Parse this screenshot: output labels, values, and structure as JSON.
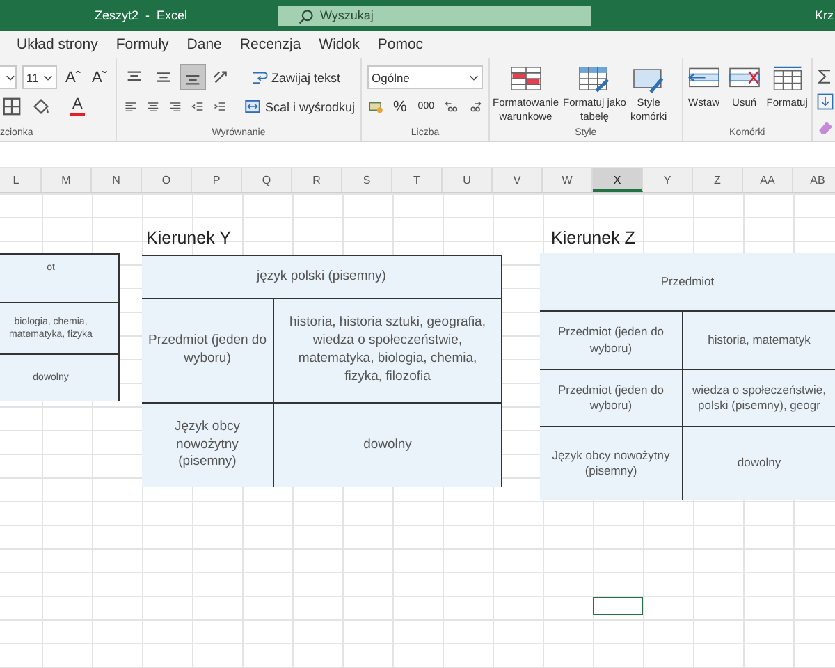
{
  "title_bar": {
    "title": "Zeszyt2  -  Excel",
    "search": {
      "placeholder": "Wyszukaj"
    },
    "user": "Krz"
  },
  "menu": [
    "Układ strony",
    "Formuły",
    "Dane",
    "Recenzja",
    "Widok",
    "Pomoc"
  ],
  "ribbon": [
    {
      "label": "zcionka",
      "rows": [
        [
          {
            "kind": "font-box"
          },
          {
            "kind": "dropdown",
            "value": "11"
          },
          {
            "kind": "glyph",
            "label": "Aˆ"
          },
          {
            "kind": "glyph",
            "label": "Aˇ"
          }
        ],
        [
          {
            "kind": "borders"
          },
          {
            "kind": "fill"
          },
          {
            "kind": "font-color",
            "label": "A"
          }
        ]
      ]
    },
    {
      "label": "Wyrównanie",
      "rows": [
        [
          {
            "kind": "align-top",
            "on": false
          },
          {
            "kind": "align-middle",
            "on": false
          },
          {
            "kind": "align-bottom",
            "on": true
          },
          {
            "kind": "orientation"
          },
          {
            "kind": "wrap",
            "label": "Zawijaj tekst"
          }
        ],
        [
          {
            "kind": "align-left",
            "on": false
          },
          {
            "kind": "align-center",
            "on": false
          },
          {
            "kind": "align-right",
            "on": false
          },
          {
            "kind": "indent-less"
          },
          {
            "kind": "indent-more"
          },
          {
            "kind": "merge",
            "label": "Scal i wyśrodkuj"
          }
        ]
      ]
    },
    {
      "label": "Liczba",
      "rows": [
        [
          {
            "kind": "dropdown-wide",
            "value": "Ogólne"
          }
        ],
        [
          {
            "kind": "currency"
          },
          {
            "kind": "glyph",
            "label": "%"
          },
          {
            "kind": "glyph-small",
            "label": "000"
          },
          {
            "kind": "dec-more"
          },
          {
            "kind": "dec-less"
          }
        ]
      ]
    },
    {
      "label": "Style",
      "large": [
        {
          "kind": "cond-format",
          "label": "Formatowanie\nwarunkowe"
        },
        {
          "kind": "table-format",
          "label": "Formatuj jako\ntabelę"
        },
        {
          "kind": "cell-styles",
          "label": "Style\nkomórki"
        }
      ]
    },
    {
      "label": "Komórki",
      "large": [
        {
          "kind": "insert",
          "label": "Wstaw"
        },
        {
          "kind": "delete",
          "label": "Usuń"
        },
        {
          "kind": "format",
          "label": "Formatuj"
        }
      ]
    }
  ],
  "sheet": {
    "columns": [
      {
        "name": "L",
        "selected": false
      },
      {
        "name": "M",
        "selected": false
      },
      {
        "name": "N",
        "selected": false
      },
      {
        "name": "O",
        "selected": false
      },
      {
        "name": "P",
        "selected": false
      },
      {
        "name": "Q",
        "selected": false
      },
      {
        "name": "R",
        "selected": false
      },
      {
        "name": "S",
        "selected": false
      },
      {
        "name": "T",
        "selected": false
      },
      {
        "name": "U",
        "selected": false
      },
      {
        "name": "V",
        "selected": false
      },
      {
        "name": "W",
        "selected": false
      },
      {
        "name": "X",
        "selected": true
      },
      {
        "name": "Y",
        "selected": false
      },
      {
        "name": "Z",
        "selected": false
      },
      {
        "name": "AA",
        "selected": false
      },
      {
        "name": "AB",
        "selected": false
      }
    ],
    "headings": [
      "Kierunek Y",
      "Kierunek Z"
    ],
    "tables": [
      {
        "rows": [
          {
            "cells": [
              "ot"
            ]
          },
          {
            "cells": [
              "biologia, chemia, matematyka, fizyka"
            ]
          },
          {
            "cells": [
              "dowolny"
            ]
          }
        ]
      },
      {
        "rows": [
          {
            "cells": [
              "język polski (pisemny)"
            ]
          },
          {
            "cells": [
              "Przedmiot (jeden do wyboru)",
              "historia, historia sztuki, geografia, wiedza o społeczeństwie, matematyka, biologia, chemia, fizyka, filozofia"
            ]
          },
          {
            "cells": [
              "Język obcy nowożytny (pisemny)",
              "dowolny"
            ]
          }
        ]
      },
      {
        "rows": [
          {
            "cells": [
              "Przedmiot"
            ]
          },
          {
            "cells": [
              "Przedmiot (jeden do wyboru)",
              "historia, matematyk"
            ]
          },
          {
            "cells": [
              "Przedmiot (jeden do wyboru)",
              "wiedza o społeczeństwie,\npolski (pisemny), geogr"
            ]
          },
          {
            "cells": [
              "Język obcy nowożytny (pisemny)",
              "dowolny"
            ]
          }
        ]
      }
    ]
  }
}
